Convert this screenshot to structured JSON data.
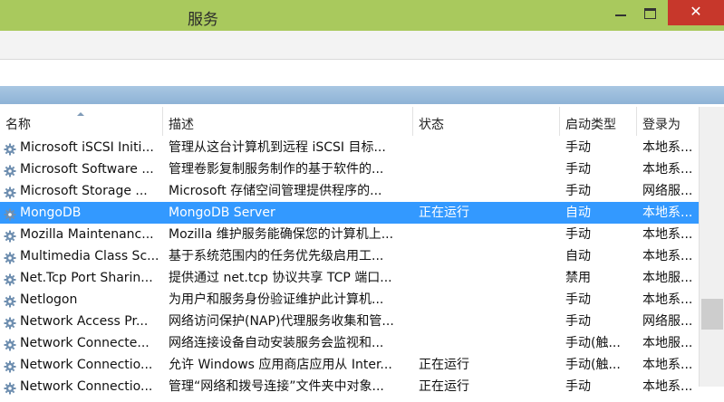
{
  "window": {
    "title": "服务"
  },
  "titlebar_colors": {
    "background": "#a9c95d",
    "close_button": "#c7372b"
  },
  "table": {
    "headers": {
      "name": "名称",
      "description": "描述",
      "status": "状态",
      "startup": "启动类型",
      "logon": "登录为"
    },
    "rows": [
      {
        "name": "Microsoft iSCSI Initi...",
        "description": "管理从这台计算机到远程 iSCSI 目标...",
        "status": "",
        "startup": "手动",
        "logon": "本地系..."
      },
      {
        "name": "Microsoft Software ...",
        "description": "管理卷影复制服务制作的基于软件的...",
        "status": "",
        "startup": "手动",
        "logon": "本地系..."
      },
      {
        "name": "Microsoft Storage ...",
        "description": "Microsoft 存储空间管理提供程序的...",
        "status": "",
        "startup": "手动",
        "logon": "网络服..."
      },
      {
        "name": "MongoDB",
        "description": "MongoDB Server",
        "status": "正在运行",
        "startup": "自动",
        "logon": "本地系...",
        "selected": true
      },
      {
        "name": "Mozilla Maintenanc...",
        "description": "Mozilla 维护服务能确保您的计算机上...",
        "status": "",
        "startup": "手动",
        "logon": "本地系..."
      },
      {
        "name": "Multimedia Class Sc...",
        "description": "基于系统范围内的任务优先级启用工...",
        "status": "",
        "startup": "自动",
        "logon": "本地系..."
      },
      {
        "name": "Net.Tcp Port Sharin...",
        "description": "提供通过 net.tcp 协议共享 TCP 端口...",
        "status": "",
        "startup": "禁用",
        "logon": "本地服..."
      },
      {
        "name": "Netlogon",
        "description": "为用户和服务身份验证维护此计算机...",
        "status": "",
        "startup": "手动",
        "logon": "本地系..."
      },
      {
        "name": "Network Access Pr...",
        "description": "网络访问保护(NAP)代理服务收集和管...",
        "status": "",
        "startup": "手动",
        "logon": "网络服..."
      },
      {
        "name": "Network Connecte...",
        "description": "网络连接设备自动安装服务会监视和...",
        "status": "",
        "startup": "手动(触...",
        "logon": "本地服..."
      },
      {
        "name": "Network Connectio...",
        "description": "允许 Windows 应用商店应用从 Inter...",
        "status": "正在运行",
        "startup": "手动(触...",
        "logon": "本地系..."
      },
      {
        "name": "Network Connectio...",
        "description": "管理“网络和拨号连接”文件夹中对象...",
        "status": "正在运行",
        "startup": "手动",
        "logon": "本地系..."
      }
    ]
  },
  "icons": {
    "service": "gear-icon",
    "minimize": "minimize-icon",
    "maximize": "maximize-icon",
    "close": "close-icon"
  },
  "close_glyph": "✕"
}
